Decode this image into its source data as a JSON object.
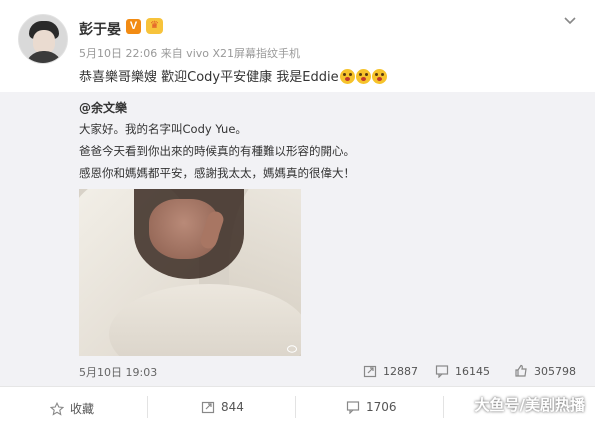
{
  "post": {
    "author": "彭于晏",
    "verified_badge": "V",
    "member_badge": "♛",
    "meta": "5月10日 22:06 来自 vivo X21屏幕指纹手机",
    "text": "恭喜樂哥樂嫂 歡迎Cody平安健康 我是Eddie",
    "emoji_count": 3
  },
  "repost": {
    "author": "@余文樂",
    "lines": [
      "大家好。我的名字叫Cody Yue。",
      "爸爸今天看到你出來的時候真的有種難以形容的開心。",
      "感恩你和媽媽都平安，感謝我太太，媽媽真的很偉大！"
    ],
    "date": "5月10日 19:03",
    "reposts": "12887",
    "comments": "16145",
    "likes": "305798"
  },
  "footer": {
    "favorite_label": "收藏",
    "repost_count": "844",
    "comment_count": "1706"
  },
  "watermark": "大鱼号/美剧热播",
  "colors": {
    "accent": "#f28b13",
    "repost_bg": "#f2f2f5"
  }
}
